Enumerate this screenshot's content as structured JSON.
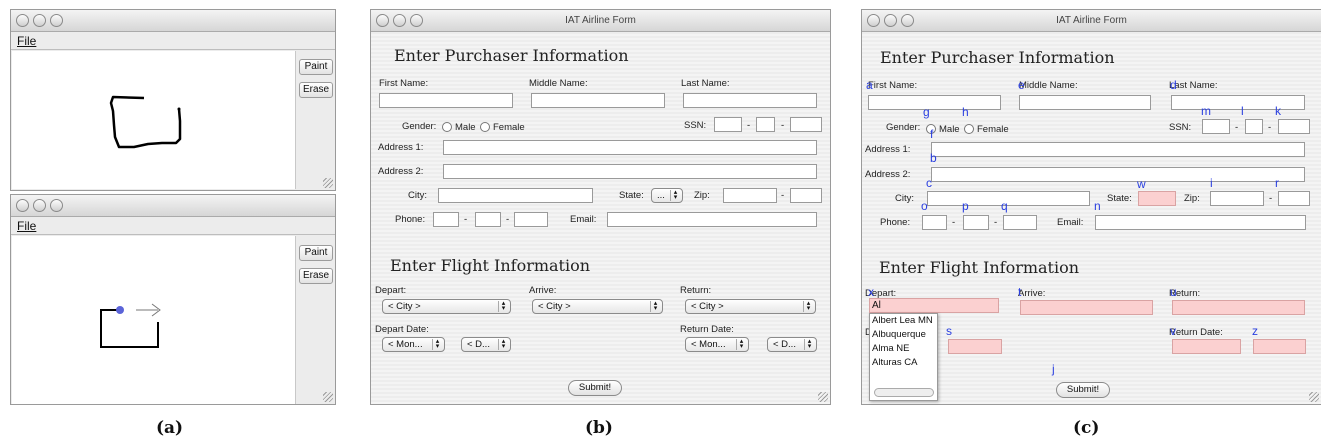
{
  "figure_labels": [
    "(a)",
    "(b)",
    "(c)"
  ],
  "paint_top": {
    "menu": "File",
    "paint_btn": "Paint",
    "erase_btn": "Erase"
  },
  "paint_bottom": {
    "menu": "File",
    "paint_btn": "Paint",
    "erase_btn": "Erase"
  },
  "form_b": {
    "window_title": "IAT Airline Form",
    "purchaser_heading": "Enter Purchaser Information",
    "first_name": "First Name:",
    "middle_name": "Middle Name:",
    "last_name": "Last Name:",
    "gender": "Gender:",
    "male": "Male",
    "female": "Female",
    "ssn": "SSN:",
    "address1": "Address 1:",
    "address2": "Address 2:",
    "city": "City:",
    "state": "State:",
    "state_value": "...",
    "zip": "Zip:",
    "phone": "Phone:",
    "email": "Email:",
    "flight_heading": "Enter Flight Information",
    "depart": "Depart:",
    "arrive": "Arrive:",
    "return": "Return:",
    "city_select": "< City >",
    "depart_date": "Depart Date:",
    "return_date": "Return Date:",
    "month_select": "< Mon...",
    "day_select": "< D...",
    "submit": "Submit!",
    "dash": "-"
  },
  "form_c": {
    "window_title": "IAT Airline Form",
    "purchaser_heading": "Enter Purchaser Information",
    "first_name": "First Name:",
    "middle_name": "Middle Name:",
    "last_name": "Last Name:",
    "gender": "Gender:",
    "male": "Male",
    "female": "Female",
    "ssn": "SSN:",
    "address1": "Address 1:",
    "address2": "Address 2:",
    "city": "City:",
    "state": "State:",
    "zip": "Zip:",
    "phone": "Phone:",
    "email": "Email:",
    "flight_heading": "Enter Flight Information",
    "depart": "Depart:",
    "arrive": "Arrive:",
    "return": "Return:",
    "depart_input_value": "Al",
    "depart_date_partial": "D",
    "return_date": "Return Date:",
    "submit": "Submit!",
    "dash": "-",
    "autocomplete_options": [
      "Albert Lea MN",
      "Albuquerque",
      "Alma NE",
      "Alturas CA"
    ],
    "annotation_letters": {
      "a": "a",
      "e": "e",
      "d": "d",
      "g": "g",
      "h": "h",
      "m": "m",
      "l": "l",
      "k": "k",
      "f": "f",
      "b": "b",
      "c": "c",
      "w": "w",
      "i": "i",
      "r": "r",
      "o": "o",
      "p": "p",
      "q": "q",
      "n": "n",
      "x": "x",
      "t": "t",
      "u": "u",
      "s": "s",
      "v": "v",
      "z": "z",
      "j": "j"
    },
    "annotation_color": "#2a3fe0",
    "error_field_color": "#fbd0d0"
  }
}
